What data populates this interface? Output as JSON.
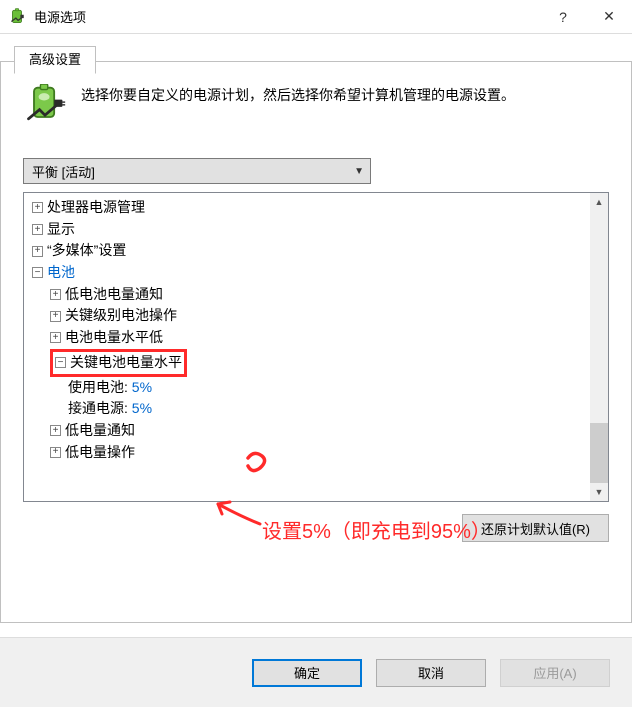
{
  "window": {
    "title": "电源选项",
    "help": "?",
    "close": "✕"
  },
  "tab": {
    "label": "高级设置"
  },
  "hero": {
    "text": "选择你要自定义的电源计划，然后选择你希望计算机管理的电源设置。"
  },
  "combo": {
    "selected": "平衡 [活动]"
  },
  "tree": {
    "n0": "处理器电源管理",
    "n1": "显示",
    "n2": "“多媒体”设置",
    "n3": "电池",
    "n3_0": "低电池电量通知",
    "n3_1": "关键级别电池操作",
    "n3_2": "电池电量水平低",
    "n3_3": "关键电池电量水平",
    "n3_3_0_label": "使用电池:",
    "n3_3_0_value": "5%",
    "n3_3_1_label": "接通电源:",
    "n3_3_1_value": "5%",
    "n3_4": "低电量通知",
    "n3_5": "低电量操作"
  },
  "restore": {
    "label": "还原计划默认值(R)"
  },
  "buttons": {
    "ok": "确定",
    "cancel": "取消",
    "apply": "应用(A)"
  },
  "annotation": {
    "mark": "6",
    "text": "设置5%（即充电到95%）"
  }
}
